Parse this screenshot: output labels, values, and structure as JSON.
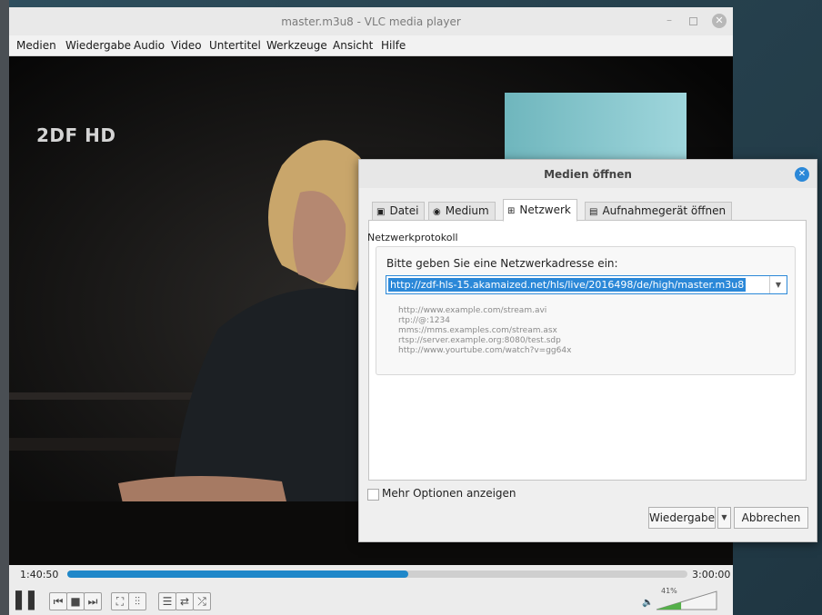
{
  "window": {
    "title": "master.m3u8 - VLC media player",
    "controls": {
      "minimize": "–",
      "close": "✕"
    }
  },
  "menubar": [
    "Medien",
    "Wiedergabe",
    "Audio",
    "Video",
    "Untertitel",
    "Werkzeuge",
    "Ansicht",
    "Hilfe"
  ],
  "video": {
    "channel_logo": "2DF HD"
  },
  "playback": {
    "elapsed": "1:40:50",
    "total": "3:00:00",
    "progress": 0.55,
    "volume_label": "41%",
    "volume": 0.41,
    "icons": [
      "pause-icon",
      "previous-icon",
      "stop-icon",
      "next-icon",
      "fullscreen-icon",
      "extended-settings-icon",
      "playlist-icon",
      "loop-icon",
      "shuffle-icon",
      "speaker-icon"
    ],
    "glyphs": {
      "pause": "▌▌",
      "prev": "⏮",
      "stop": "■",
      "next": "⏭",
      "fullscreen": "⛶",
      "extended": "⫶⫶",
      "playlist": "☰",
      "loop": "⇄",
      "shuffle": "⤮",
      "speaker": "🔈"
    }
  },
  "dialog": {
    "title": "Medien öffnen",
    "close": "✕",
    "tabs": [
      {
        "label": "Datei",
        "icon": "▣"
      },
      {
        "label": "Medium",
        "icon": "◉"
      },
      {
        "label": "Netzwerk",
        "icon": "⊞"
      },
      {
        "label": "Aufnahmegerät öffnen",
        "icon": "▤"
      }
    ],
    "active_tab": "Netzwerk",
    "group_title": "Netzwerkprotokoll",
    "prompt": "Bitte geben Sie eine Netzwerkadresse ein:",
    "url_value": "http://zdf-hls-15.akamaized.net/hls/live/2016498/de/high/master.m3u8",
    "dropdown_arrow": "▼",
    "examples": [
      "http://www.example.com/stream.avi",
      "rtp://@:1234",
      "mms://mms.examples.com/stream.asx",
      "rtsp://server.example.org:8080/test.sdp",
      "http://www.yourtube.com/watch?v=gg64x"
    ],
    "more_options_label": "Mehr Optionen anzeigen",
    "play_button": "Wiedergabe",
    "cancel_button": "Abbrechen"
  }
}
